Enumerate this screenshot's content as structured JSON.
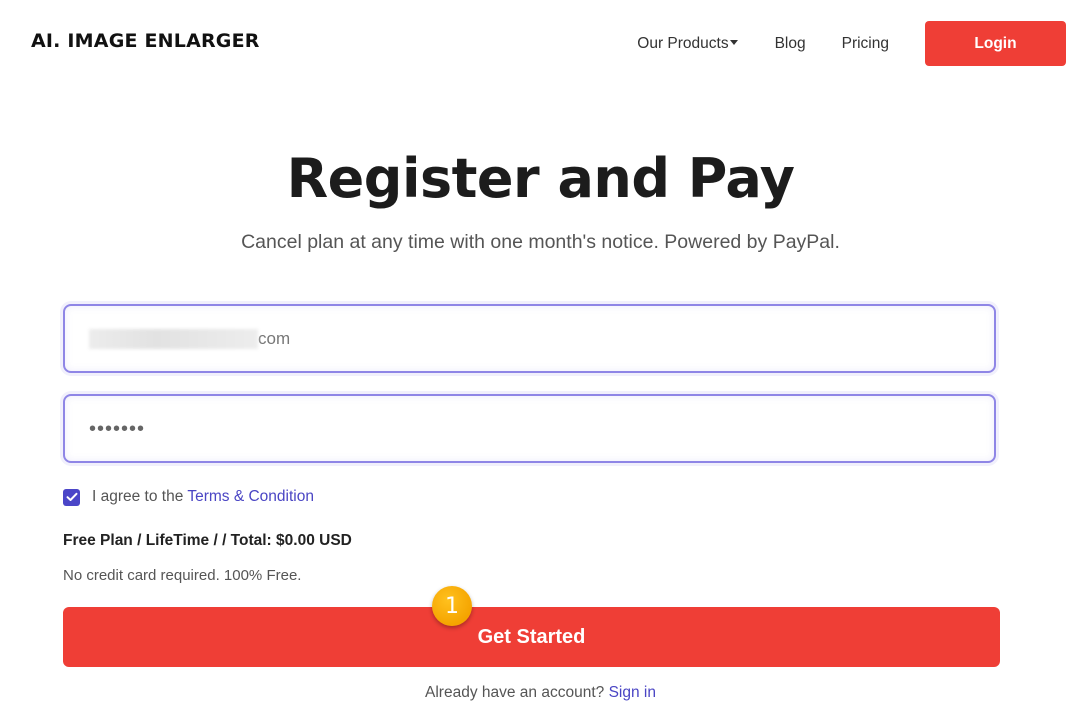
{
  "header": {
    "brand": "AI. IMAGE ENLARGER",
    "nav": {
      "products": "Our Products",
      "blog": "Blog",
      "pricing": "Pricing",
      "login": "Login"
    }
  },
  "main": {
    "title": "Register and Pay",
    "subtitle": "Cancel plan at any time with one month's notice. Powered by PayPal.",
    "email_visible_suffix": "com",
    "password_dots": "•••••••",
    "agree_prefix": "I agree to the",
    "terms_link": "Terms & Condition",
    "agree_checked": true,
    "plan_summary": "Free Plan / LifeTime / / Total: $0.00 USD",
    "no_credit_card": "No credit card required. 100% Free.",
    "cta_label": "Get Started",
    "step_number": "1",
    "already_text": "Already have an account?",
    "signin_link": "Sign in"
  },
  "colors": {
    "accent_red": "#ef3e36",
    "link_purple": "#4a45c4",
    "field_border": "#8f86e6",
    "badge_orange": "#f5a400"
  },
  "icons": {
    "products_caret": "caret-down-icon",
    "checkbox": "checkmark-icon"
  }
}
